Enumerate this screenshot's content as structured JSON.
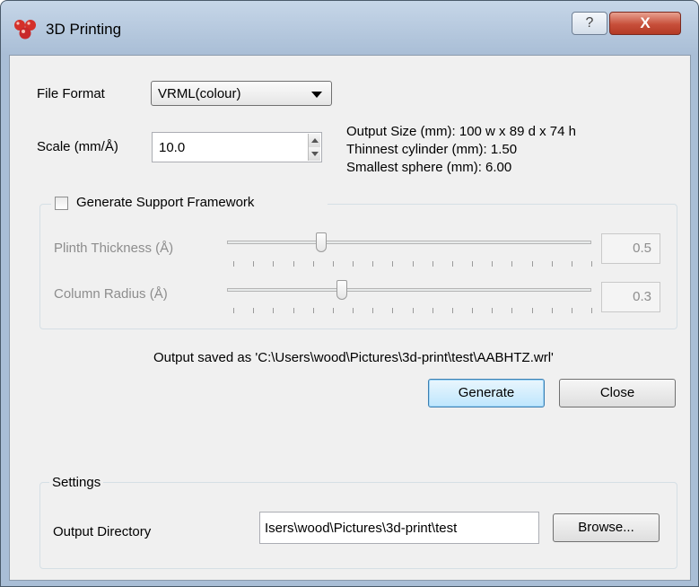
{
  "window": {
    "title": "3D Printing",
    "help_label": "?",
    "close_label": "X"
  },
  "file_format": {
    "label": "File Format",
    "selected": "VRML(colour)"
  },
  "scale": {
    "label": "Scale (mm/Å)",
    "value": "10.0"
  },
  "info": {
    "output_size": "Output Size (mm): 100 w x 89 d x 74 h",
    "thinnest_cylinder": "Thinnest cylinder (mm): 1.50",
    "smallest_sphere": "Smallest sphere (mm): 6.00"
  },
  "support": {
    "checkbox_label": "Generate Support Framework",
    "checked": false,
    "plinth": {
      "label": "Plinth Thickness (Å)",
      "value": "0.5",
      "slider_fraction": 0.25
    },
    "column": {
      "label": "Column Radius (Å)",
      "value": "0.3",
      "slider_fraction": 0.31
    }
  },
  "status": {
    "message": "Output saved as 'C:\\Users\\wood\\Pictures\\3d-print\\test\\AABHTZ.wrl'"
  },
  "actions": {
    "generate_label": "Generate",
    "close_label": "Close"
  },
  "settings": {
    "group_title": "Settings",
    "output_directory_label": "Output Directory",
    "output_directory_value": "Isers\\wood\\Pictures\\3d-print\\test",
    "browse_label": "Browse..."
  }
}
